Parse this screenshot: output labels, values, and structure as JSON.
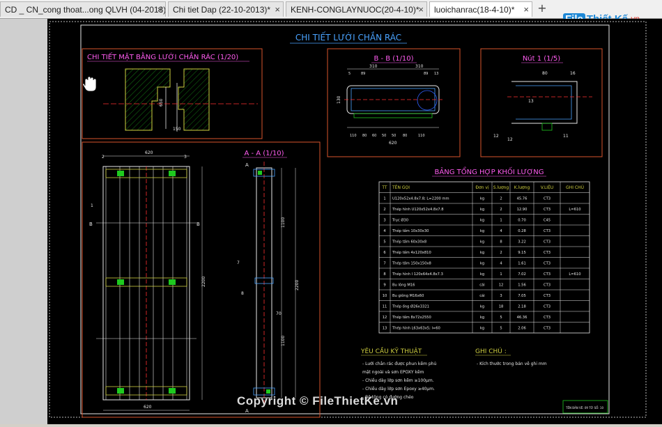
{
  "tabs": [
    {
      "label": "CD _ CN_cong thoat...ong QLVH (04-2013)*",
      "active": false
    },
    {
      "label": "Chi tiet Dap (22-10-2013)*",
      "active": false
    },
    {
      "label": "KENH-CONGLAYNUOC(20-4-10)*",
      "active": false
    },
    {
      "label": "luoichanrac(18-4-10)*",
      "active": true
    }
  ],
  "close_glyph": "×",
  "add_glyph": "+",
  "logo": {
    "file": "File",
    "rest": "Thiết Kế",
    "vn": ".vn"
  },
  "watermark": "Copyright © FileThietKe.vn",
  "drawing": {
    "main_title": "CHI TIẾT LƯỚI CHẮN RÁC",
    "plan_title": "CHI TIẾT MẶT BẰNG LƯỚI CHẮN RÁC (1/20)",
    "bb_title": "B - B (1/10)",
    "nut_title": "Nút 1 (1/5)",
    "aa_title": "A - A (1/10)",
    "table_title": "BẢNG TỔNG HỢP KHỐI LƯỢNG",
    "req_title": "YÊU CẦU KỸ THUẬT",
    "req_lines": [
      "- Lưới chắn rác được phun kẽm phủ",
      "mặt ngoài và sơn EPOXY kẽm",
      "- Chiều dày lớp sơn kẽm ≥100µm.",
      "- Chiều dày lớp sơn Epoxy ≥40µm.",
      "- Bê tông có đường chéo"
    ],
    "note_title": "GHI CHÚ :",
    "note_lines": [
      "- Kích thước trong bản vẽ ghi mm"
    ],
    "stamp": "TÊN BẢN VẼ: 09   TỜ SỐ: 10",
    "plan_dims": [
      "650",
      "150"
    ],
    "bb_dims_top": [
      "310",
      "310"
    ],
    "bb_dims_sub": [
      "5",
      "89",
      "89",
      "13"
    ],
    "bb_dims_bottom": [
      "110",
      "80",
      "60",
      "50",
      "50",
      "80",
      "110"
    ],
    "bb_total": "620",
    "bb_side": "130",
    "nut_dims": [
      "80",
      "16",
      "13",
      "12",
      "12",
      "11",
      "12",
      "8",
      "13"
    ],
    "front_dims": [
      "620",
      "620",
      "2200"
    ],
    "aa_dims": [
      "1100",
      "1100",
      "2200",
      "70"
    ],
    "leader_labels": [
      "1",
      "2",
      "3",
      "4",
      "5",
      "6",
      "7",
      "8",
      "9",
      "10",
      "11",
      "12",
      "13"
    ],
    "cut_labels": [
      "B",
      "B",
      "A",
      "A",
      "B",
      "B"
    ],
    "table": {
      "headers": [
        "TT",
        "TÊN GỌI",
        "Đơn vị",
        "S.lượng",
        "K.lượng",
        "V.LIỆU",
        "GHI CHÚ"
      ],
      "rows": [
        [
          "1",
          "U120x52x4.8x7.8; L=2200 mm",
          "kg",
          "2",
          "45.76",
          "CT3",
          ""
        ],
        [
          "2",
          "Thép hình U120x52x4.8x7.8",
          "kg",
          "2",
          "12.90",
          "CT3",
          "L=610"
        ],
        [
          "3",
          "Trục Ø30",
          "kg",
          "1",
          "0.70",
          "C45",
          ""
        ],
        [
          "4",
          "Thép tấm 10x30x30",
          "kg",
          "4",
          "0.28",
          "CT3",
          ""
        ],
        [
          "5",
          "Thép tấm 60x30x8",
          "kg",
          "8",
          "3.22",
          "CT3",
          ""
        ],
        [
          "6",
          "Thép tấm 4x120x810",
          "kg",
          "2",
          "9.15",
          "CT3",
          ""
        ],
        [
          "7",
          "Thép tấm 150x150x8",
          "kg",
          "4",
          "1.61",
          "CT3",
          ""
        ],
        [
          "8",
          "Thép hình I 120x64x4.8x7.3",
          "kg",
          "1",
          "7.02",
          "CT3",
          "L=610"
        ],
        [
          "9",
          "Bu lông M16",
          "cái",
          "12",
          "1.56",
          "CT3",
          ""
        ],
        [
          "10",
          "Bu giông M16x60",
          "cái",
          "3",
          "7.05",
          "CT3",
          ""
        ],
        [
          "11",
          "Thép ống Ø26x3321",
          "kg",
          "18",
          "2.18",
          "CT3",
          ""
        ],
        [
          "12",
          "Thép tấm 8x72x2550",
          "kg",
          "5",
          "46.36",
          "CT3",
          ""
        ],
        [
          "13",
          "Thép hình L63x63x5; l=60",
          "kg",
          "5",
          "2.06",
          "CT3",
          ""
        ]
      ]
    }
  }
}
